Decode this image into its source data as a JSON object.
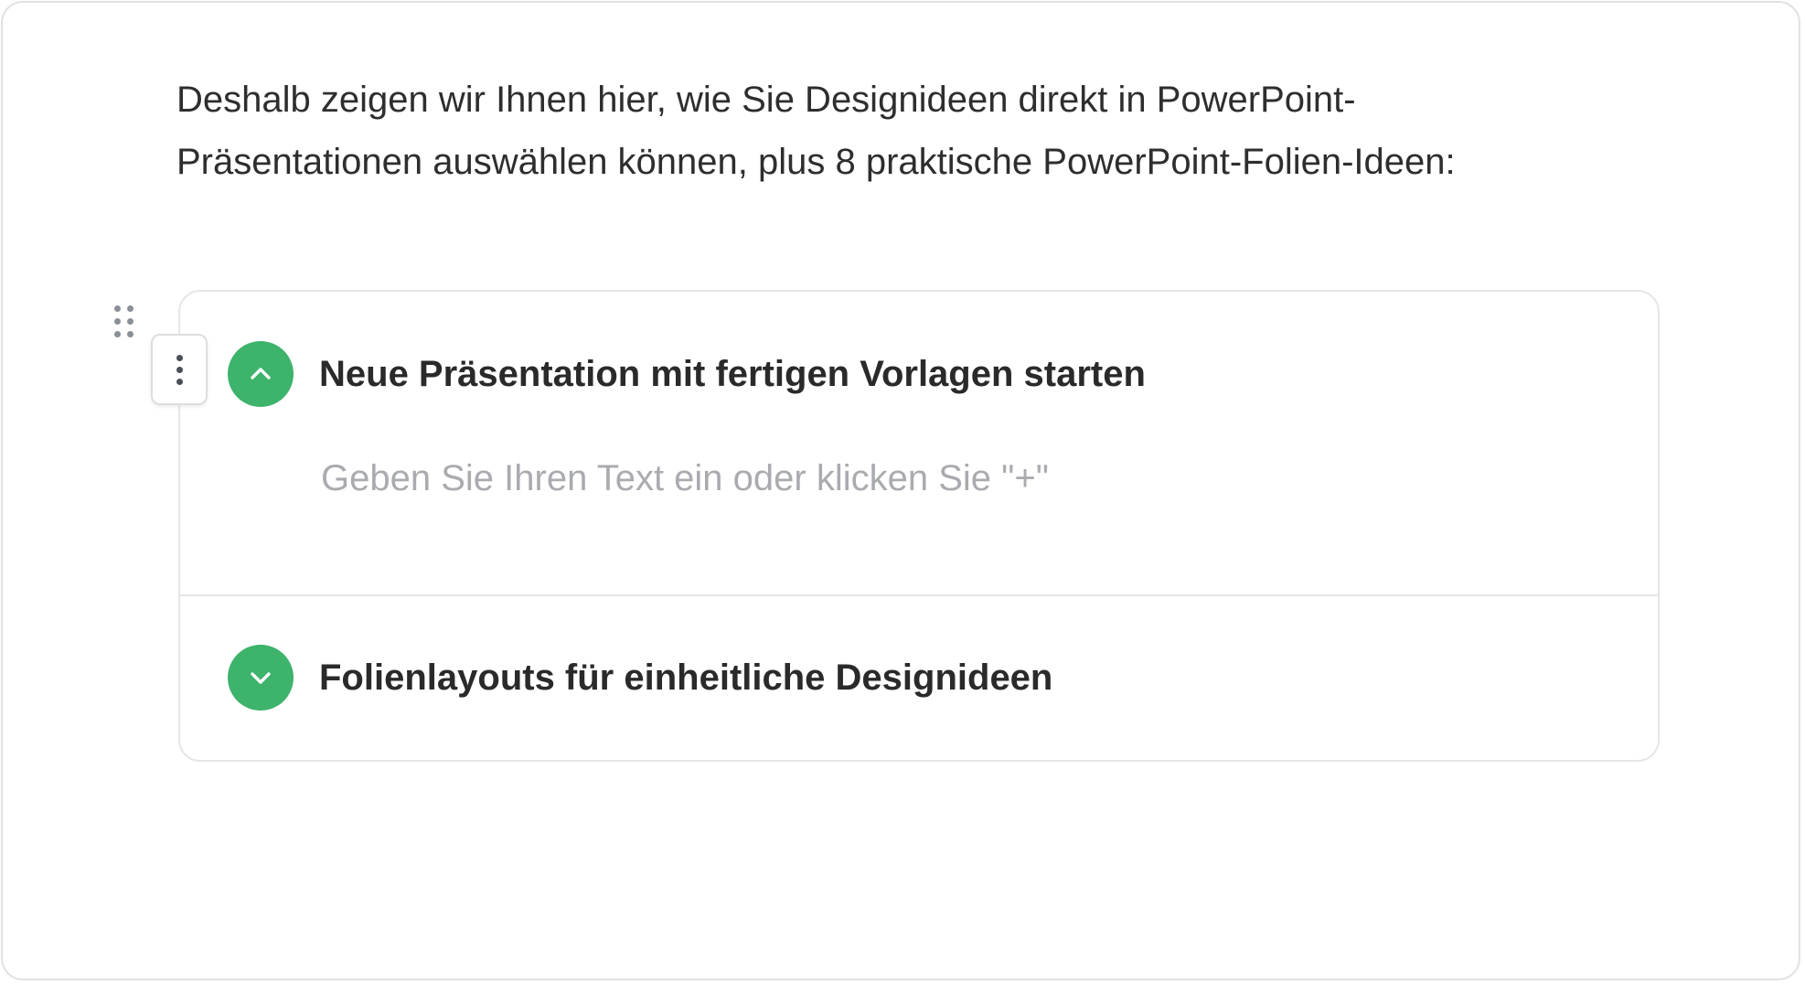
{
  "intro": {
    "line1": "Deshalb zeigen wir Ihnen hier, wie Sie Designideen direkt in PowerPoint-",
    "line2": "Präsentationen auswählen können, plus 8 praktische PowerPoint-Folien-Ideen:"
  },
  "accordion": {
    "items": [
      {
        "title": "Neue Präsentation mit fertigen Vorlagen starten",
        "expanded": true,
        "toggle_icon": "chevron-up-icon",
        "body_placeholder": "Geben Sie Ihren Text ein oder klicken Sie \"+\""
      },
      {
        "title": "Folienlayouts für einheitliche Designideen",
        "expanded": false,
        "toggle_icon": "chevron-down-icon"
      }
    ]
  },
  "icons": {
    "drag_handle": "drag-handle-icon",
    "block_menu": "more-vertical-icon"
  },
  "colors": {
    "accent": "#3db36b",
    "placeholder": "#a9abaf",
    "border": "#e6e6e6"
  }
}
